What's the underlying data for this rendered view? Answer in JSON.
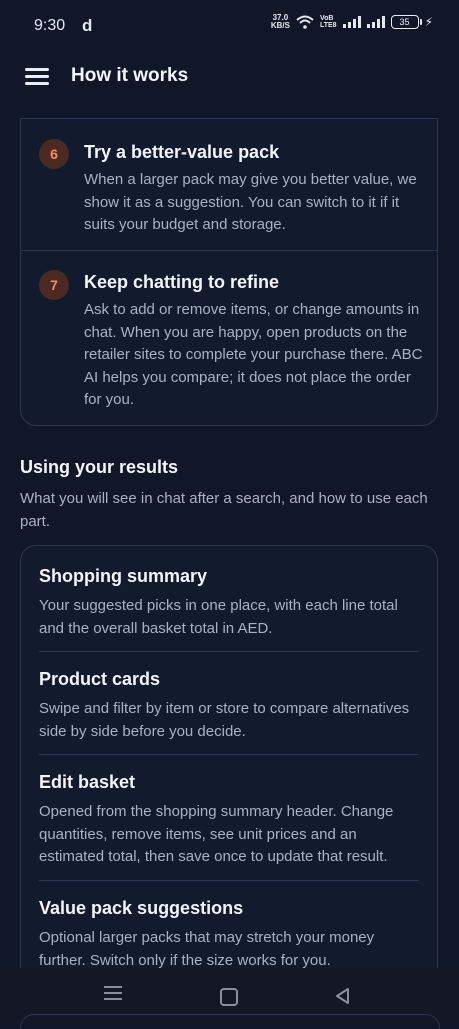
{
  "status_bar": {
    "time": "9:30",
    "app_glyph": "d",
    "net_speed_value": "37.0",
    "net_speed_unit": "KB/S",
    "volte_line1": "VoB",
    "volte_line2": "LTE8",
    "battery": "35"
  },
  "appbar": {
    "title": "How it works",
    "menu_icon": "hamburger-menu-icon"
  },
  "steps": [
    {
      "number": "6",
      "title": "Try a better-value pack",
      "body": "When a larger pack may give you better value, we show it as a suggestion. You can switch to it if it suits your budget and storage."
    },
    {
      "number": "7",
      "title": "Keep chatting to refine",
      "body": "Ask to add or remove items, or change amounts in chat. When you are happy, open products on the retailer sites to complete your purchase there. ABC AI helps you compare; it does not place the order for you."
    }
  ],
  "section": {
    "title": "Using your results",
    "subtitle": "What you will see in chat after a search, and how to use each part."
  },
  "results": [
    {
      "title": "Shopping summary",
      "body": "Your suggested picks in one place, with each line total and the overall basket total in AED."
    },
    {
      "title": "Product cards",
      "body": "Swipe and filter by item or store to compare alternatives side by side before you decide."
    },
    {
      "title": "Edit basket",
      "body": "Opened from the shopping summary header. Change quantities, remove items, see unit prices and an estimated total, then save once to update that result."
    },
    {
      "title": "Value pack suggestions",
      "body": "Optional larger packs that may stretch your money further. Switch only if the size works for you."
    }
  ],
  "colors": {
    "background": "#0f1729",
    "card": "#121b2e",
    "step_badge_bg": "#4a2a22",
    "step_badge_text": "#ff8a5c"
  }
}
